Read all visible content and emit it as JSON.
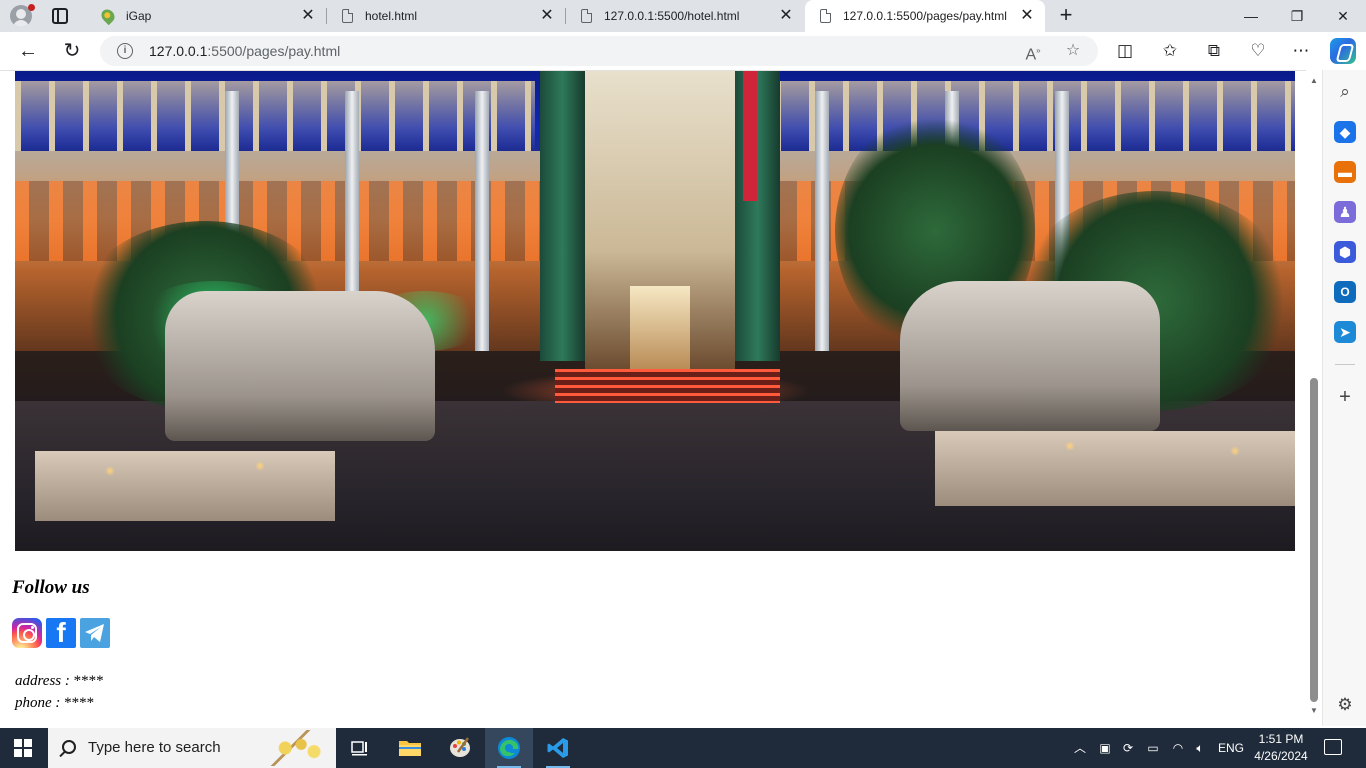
{
  "browser": {
    "tabs": [
      {
        "label": "iGap",
        "icon": "map-pin-icon",
        "active": false
      },
      {
        "label": "hotel.html",
        "icon": "document-icon",
        "active": false
      },
      {
        "label": "127.0.0.1:5500/hotel.html",
        "icon": "document-icon",
        "active": false
      },
      {
        "label": "127.0.0.1:5500/pages/pay.html",
        "icon": "document-icon",
        "active": true
      }
    ],
    "address": {
      "host": "127.0.0.1",
      "path": ":5500/pages/pay.html"
    },
    "window_controls": {
      "minimize": "—",
      "restore": "❐",
      "close": "✕"
    }
  },
  "page": {
    "hero_image": "hotel-entrance-night-photo",
    "follow_heading": "Follow us",
    "social": [
      {
        "name": "instagram",
        "icon": "instagram-icon"
      },
      {
        "name": "facebook",
        "icon": "facebook-icon",
        "glyph": "f"
      },
      {
        "name": "telegram",
        "icon": "telegram-icon"
      }
    ],
    "address_label": "address :",
    "address_value": "****",
    "phone_label": "phone :",
    "phone_value": "****"
  },
  "taskbar": {
    "search_placeholder": "Type here to search",
    "language": "ENG",
    "time": "1:51 PM",
    "date": "4/26/2024"
  },
  "colors": {
    "accent_blue": "#0078d4",
    "taskbar_bg": "#1f2b3a",
    "tab_strip_bg": "#dfe3e8"
  }
}
